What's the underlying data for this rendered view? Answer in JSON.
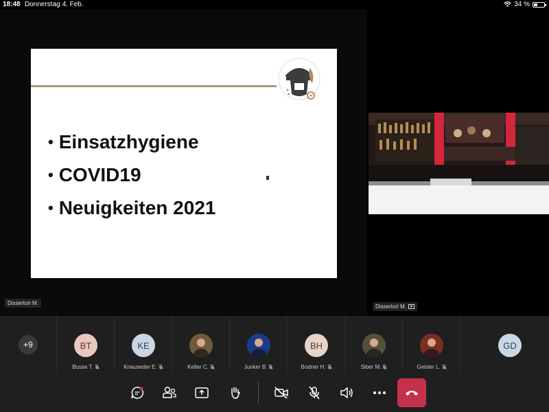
{
  "status": {
    "time": "18:48",
    "date": "Donnerstag 4. Feb.",
    "battery": "34 %",
    "battery_level": 0.34
  },
  "slide": {
    "bullets": [
      "Einsatzhygiene",
      "COVID19",
      "Neuigkeiten 2021"
    ],
    "logo_text": "FREIWILLIGE FEUERWEHR HALL IN TIROL"
  },
  "main_video": {
    "presenter": "Dissertori M."
  },
  "side_video": {
    "presenter": "Dissertori M."
  },
  "participants": {
    "overflow": "+9",
    "items": [
      {
        "name": "Busse T.",
        "initials": "BT",
        "color": "#e8c8c0",
        "fg": "#6b2c22",
        "photo": false
      },
      {
        "name": "Knauseder E.",
        "initials": "KE",
        "color": "#c9d7e4",
        "fg": "#2b4358",
        "photo": false
      },
      {
        "name": "Keller C.",
        "initials": "",
        "color": "#6e5a3e",
        "fg": "#fff",
        "photo": true
      },
      {
        "name": "Junker B.",
        "initials": "",
        "color": "#1d3b8a",
        "fg": "#fff",
        "photo": true
      },
      {
        "name": "Bodner H.",
        "initials": "BH",
        "color": "#e7d3c8",
        "fg": "#5b3b2e",
        "photo": false
      },
      {
        "name": "Siber M.",
        "initials": "",
        "color": "#55503b",
        "fg": "#fff",
        "photo": true
      },
      {
        "name": "Geisler L.",
        "initials": "",
        "color": "#7a2e22",
        "fg": "#fff",
        "photo": true
      }
    ],
    "last": {
      "initials": "GD",
      "color": "#c9d7e4",
      "fg": "#2b4358"
    }
  },
  "toolbar": {
    "buttons": [
      "chat-icon",
      "people-icon",
      "share-icon",
      "raise-hand-icon",
      "camera-off-icon",
      "mic-off-icon",
      "speaker-icon",
      "more-icon"
    ],
    "hangup": "hang-up-icon"
  }
}
